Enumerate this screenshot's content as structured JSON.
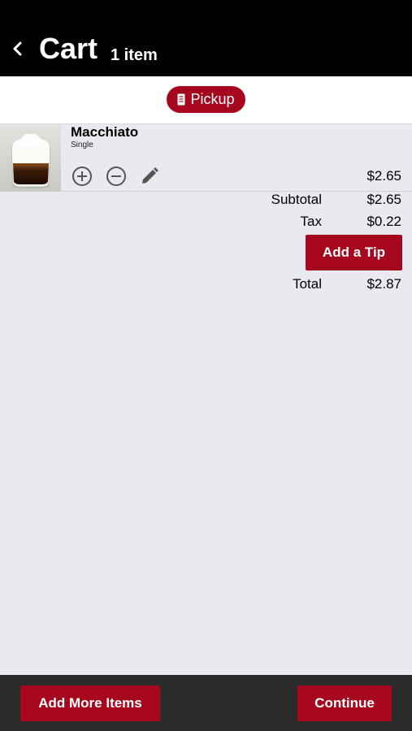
{
  "header": {
    "title": "Cart",
    "item_count": "1 item"
  },
  "order_mode": {
    "label": "Pickup",
    "icon": "receipt-icon"
  },
  "cart_items": [
    {
      "name": "Macchiato",
      "option": "Single",
      "price": "$2.65",
      "actions": [
        "plus-circle-icon",
        "minus-circle-icon",
        "pencil-icon"
      ]
    }
  ],
  "summary": {
    "subtotal_label": "Subtotal",
    "subtotal_value": "$2.65",
    "tax_label": "Tax",
    "tax_value": "$0.22",
    "tip_button": "Add a Tip",
    "total_label": "Total",
    "total_value": "$2.87"
  },
  "footer": {
    "add_more_label": "Add More Items",
    "continue_label": "Continue"
  },
  "colors": {
    "accent": "#a6071e",
    "header_bg": "#000000",
    "page_bg": "#e9e9ef",
    "footer_bg": "#2b2b2b"
  }
}
